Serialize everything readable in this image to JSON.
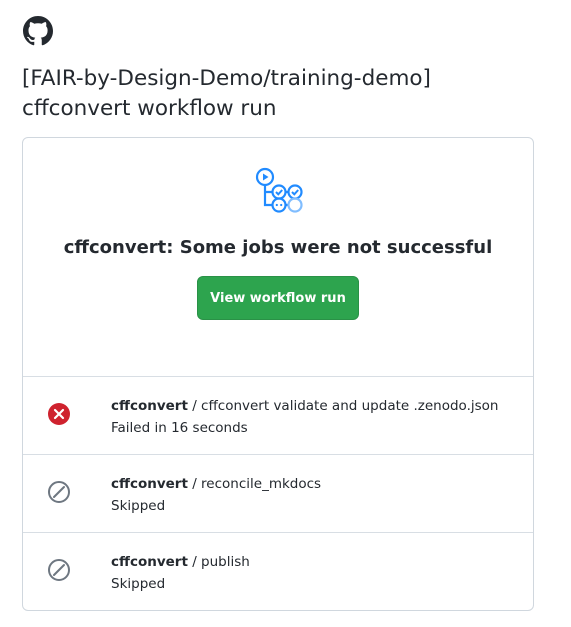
{
  "header": {
    "logo_icon": "github-mark-icon",
    "title_line1": "[FAIR-by-Design-Demo/training-demo]",
    "title_line2": "cffconvert workflow run"
  },
  "summary": {
    "icon": "workflow-icon",
    "heading": "cffconvert: Some jobs were not successful",
    "button_label": "View workflow run",
    "accent_color": "#2da44e"
  },
  "jobs": [
    {
      "workflow": "cffconvert",
      "separator": " / ",
      "name": "cffconvert validate and update .zenodo.json",
      "status": "Failed in 16 seconds",
      "icon": "x-circle-fill-icon",
      "icon_color": "#cf222e"
    },
    {
      "workflow": "cffconvert",
      "separator": " / ",
      "name": "reconcile_mkdocs",
      "status": "Skipped",
      "icon": "skip-icon",
      "icon_color": "#6e7781"
    },
    {
      "workflow": "cffconvert",
      "separator": " / ",
      "name": "publish",
      "status": "Skipped",
      "icon": "skip-icon",
      "icon_color": "#6e7781"
    }
  ]
}
